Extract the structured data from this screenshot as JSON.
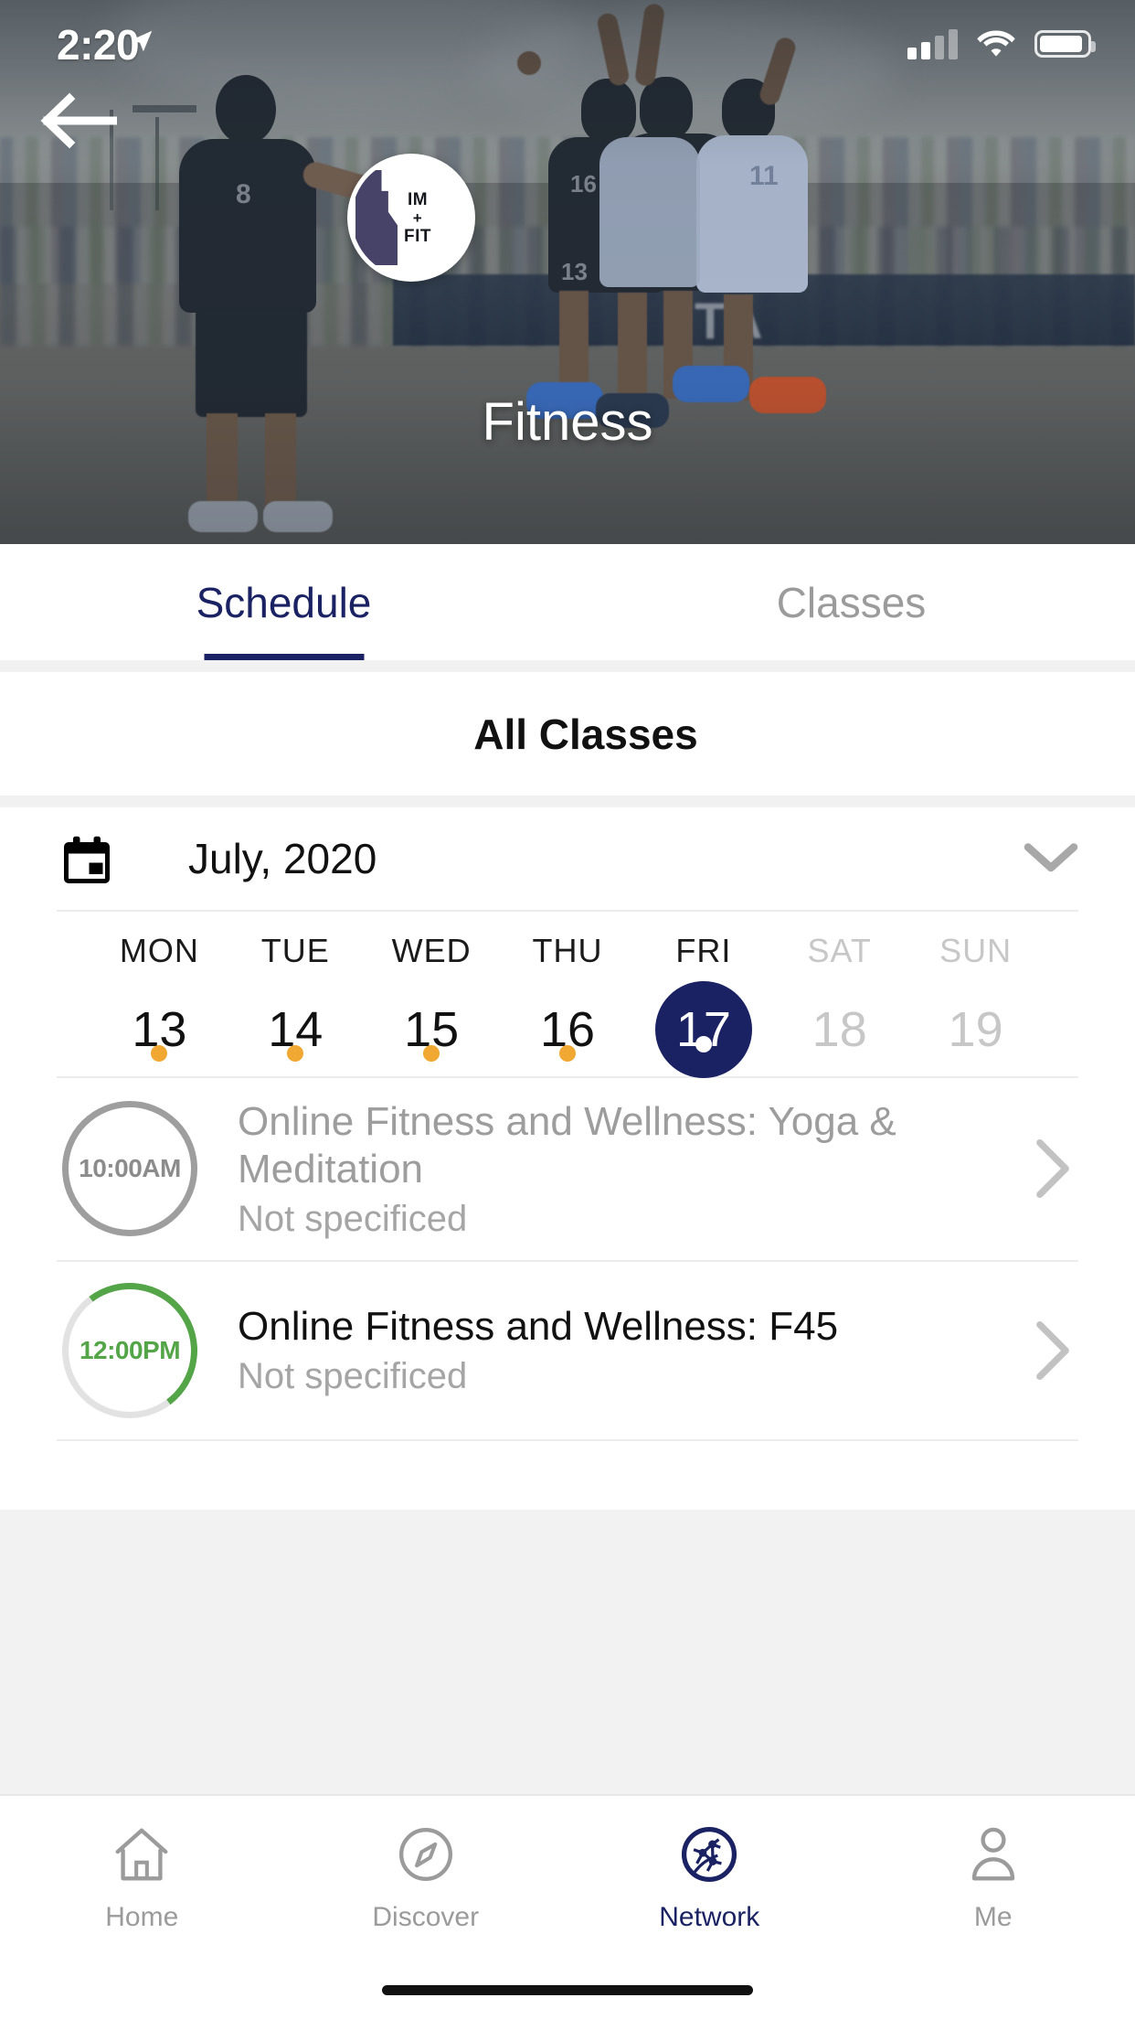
{
  "status_bar": {
    "time": "2:20",
    "location_icon": "location-arrow-icon",
    "signal_icon": "cellular-signal-icon",
    "wifi_icon": "wifi-icon",
    "battery_icon": "battery-icon"
  },
  "hero": {
    "back_icon": "back-arrow-icon",
    "logo_line1": "IM",
    "logo_plus": "+",
    "logo_line2": "FIT",
    "title": "Fitness"
  },
  "tabs": [
    {
      "label": "Schedule",
      "active": true
    },
    {
      "label": "Classes",
      "active": false
    }
  ],
  "filter": {
    "label": "All Classes"
  },
  "calendar": {
    "icon": "calendar-icon",
    "month_label": "July,  2020",
    "expand_icon": "chevron-down-icon",
    "days": [
      {
        "dow": "MON",
        "num": "13",
        "dim": false,
        "selected": false,
        "dot": "orange"
      },
      {
        "dow": "TUE",
        "num": "14",
        "dim": false,
        "selected": false,
        "dot": "orange"
      },
      {
        "dow": "WED",
        "num": "15",
        "dim": false,
        "selected": false,
        "dot": "orange"
      },
      {
        "dow": "THU",
        "num": "16",
        "dim": false,
        "selected": false,
        "dot": "orange"
      },
      {
        "dow": "FRI",
        "num": "17",
        "dim": false,
        "selected": true,
        "dot": "white"
      },
      {
        "dow": "SAT",
        "num": "18",
        "dim": true,
        "selected": false,
        "dot": "none"
      },
      {
        "dow": "SUN",
        "num": "19",
        "dim": true,
        "selected": false,
        "dot": "none"
      }
    ]
  },
  "classes": [
    {
      "time": "10:00AM",
      "title": "Online Fitness and Wellness:  Yoga & Meditation",
      "subtitle": "Not specificed",
      "state": "past",
      "chevron_icon": "chevron-right-icon"
    },
    {
      "time": "12:00PM",
      "title": "Online Fitness and Wellness: F45",
      "subtitle": "Not specificed",
      "state": "current",
      "chevron_icon": "chevron-right-icon"
    }
  ],
  "bottom_nav": [
    {
      "label": "Home",
      "icon": "home-icon",
      "active": false
    },
    {
      "label": "Discover",
      "icon": "compass-icon",
      "active": false
    },
    {
      "label": "Network",
      "icon": "network-icon",
      "active": true
    },
    {
      "label": "Me",
      "icon": "person-icon",
      "active": false
    }
  ],
  "colors": {
    "accent_navy": "#1b2263",
    "dot_orange": "#f0a832",
    "progress_green": "#53a548",
    "muted_grey": "#9b9b9b"
  }
}
